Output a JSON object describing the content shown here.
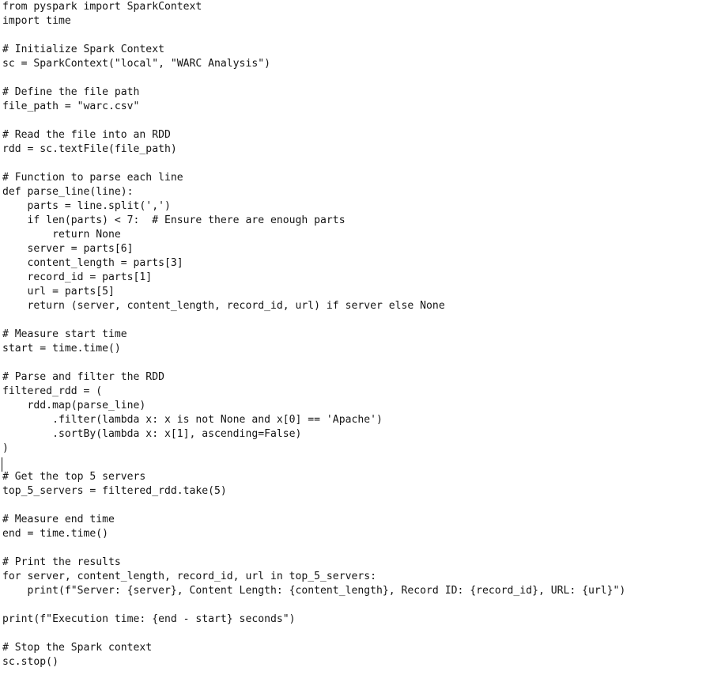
{
  "editor": {
    "language": "python",
    "background_color": "#ffffff",
    "text_color": "#141414",
    "caret": {
      "visible": true,
      "line_number": 33,
      "column": 0
    },
    "code_lines": [
      "from pyspark import SparkContext",
      "import time",
      "",
      "# Initialize Spark Context",
      "sc = SparkContext(\"local\", \"WARC Analysis\")",
      "",
      "# Define the file path",
      "file_path = \"warc.csv\"",
      "",
      "# Read the file into an RDD",
      "rdd = sc.textFile(file_path)",
      "",
      "# Function to parse each line",
      "def parse_line(line):",
      "    parts = line.split(',')",
      "    if len(parts) < 7:  # Ensure there are enough parts",
      "        return None",
      "    server = parts[6]",
      "    content_length = parts[3]",
      "    record_id = parts[1]",
      "    url = parts[5]",
      "    return (server, content_length, record_id, url) if server else None",
      "",
      "# Measure start time",
      "start = time.time()",
      "",
      "# Parse and filter the RDD",
      "filtered_rdd = (",
      "    rdd.map(parse_line)",
      "        .filter(lambda x: x is not None and x[0] == 'Apache')",
      "        .sortBy(lambda x: x[1], ascending=False)",
      ")",
      "",
      "# Get the top 5 servers",
      "top_5_servers = filtered_rdd.take(5)",
      "",
      "# Measure end time",
      "end = time.time()",
      "",
      "# Print the results",
      "for server, content_length, record_id, url in top_5_servers:",
      "    print(f\"Server: {server}, Content Length: {content_length}, Record ID: {record_id}, URL: {url}\")",
      "",
      "print(f\"Execution time: {end - start} seconds\")",
      "",
      "# Stop the Spark context",
      "sc.stop()"
    ]
  }
}
